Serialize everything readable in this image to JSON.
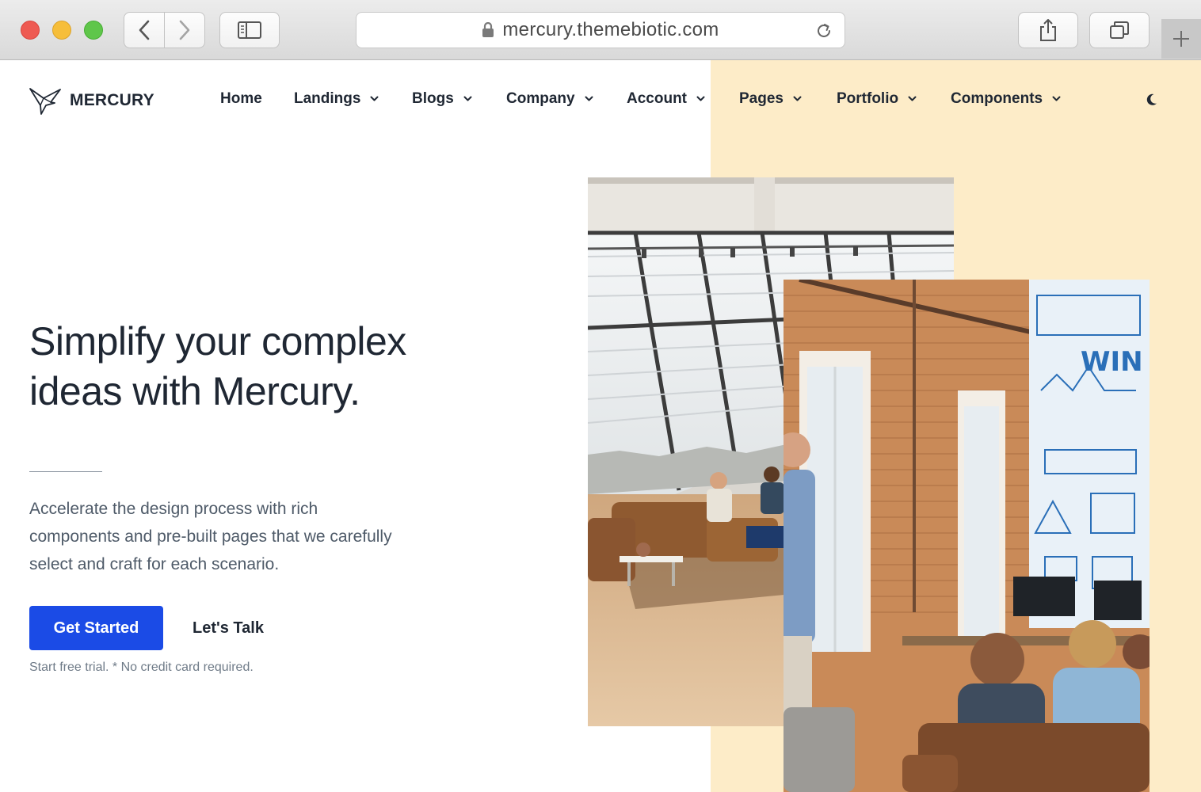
{
  "browser": {
    "url": "mercury.themebiotic.com"
  },
  "brand": {
    "name": "MERCURY"
  },
  "nav": {
    "items": [
      {
        "label": "Home"
      },
      {
        "label": "Landings"
      },
      {
        "label": "Blogs"
      },
      {
        "label": "Company"
      },
      {
        "label": "Account"
      },
      {
        "label": "Pages"
      },
      {
        "label": "Portfolio"
      },
      {
        "label": "Components"
      }
    ],
    "theme_toggle_icon": "moon-icon"
  },
  "hero": {
    "headline_line1": "Simplify your complex",
    "headline_line2": "ideas with Mercury.",
    "lead_line1": "Accelerate the design process with rich",
    "lead_line2": "components and pre-built pages that we carefully",
    "lead_line3": "select and craft for each scenario.",
    "primary_cta": "Get Started",
    "secondary_cta": "Let's Talk",
    "note": "Start free trial. * No credit card required."
  },
  "colors": {
    "accent": "#1b4be6",
    "cream_panel": "#fdecc8",
    "text": "#1f2733"
  }
}
